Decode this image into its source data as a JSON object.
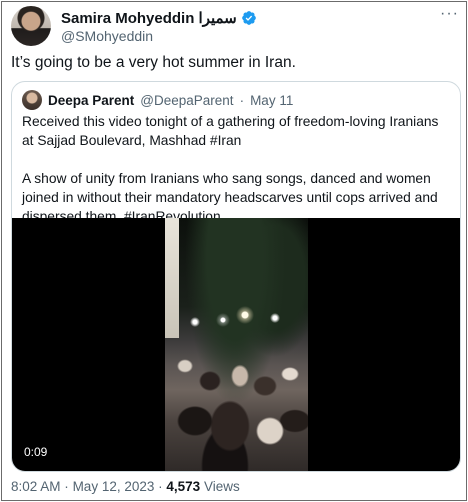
{
  "author": {
    "name": "Samira Mohyeddin سمیرا",
    "handle": "@SMohyeddin",
    "verified_icon": "verified-badge-icon",
    "more_icon": "more-horizontal-icon"
  },
  "tweet": {
    "text": "It’s going to be a very hot summer in Iran."
  },
  "quote": {
    "name": "Deepa Parent",
    "handle": "@DeepaParent",
    "separator": "·",
    "date": "May 11",
    "paragraph1": "Received this video tonight of a gathering of freedom-loving Iranians at Sajjad Boulevard, Mashhad #Iran",
    "paragraph2": "A show of unity from Iranians who sang songs, danced and women joined in without their mandatory headscarves until cops arrived and dispersed them. #IranRevolution",
    "video_duration": "0:09"
  },
  "footer": {
    "time": "8:02 AM",
    "sep1": "·",
    "date": "May 12, 2023",
    "sep2": "·",
    "views_count": "4,573",
    "views_label": "Views"
  },
  "colors": {
    "verified": "#1d9bf0",
    "secondary_text": "#536471",
    "border": "#cfd9de"
  }
}
